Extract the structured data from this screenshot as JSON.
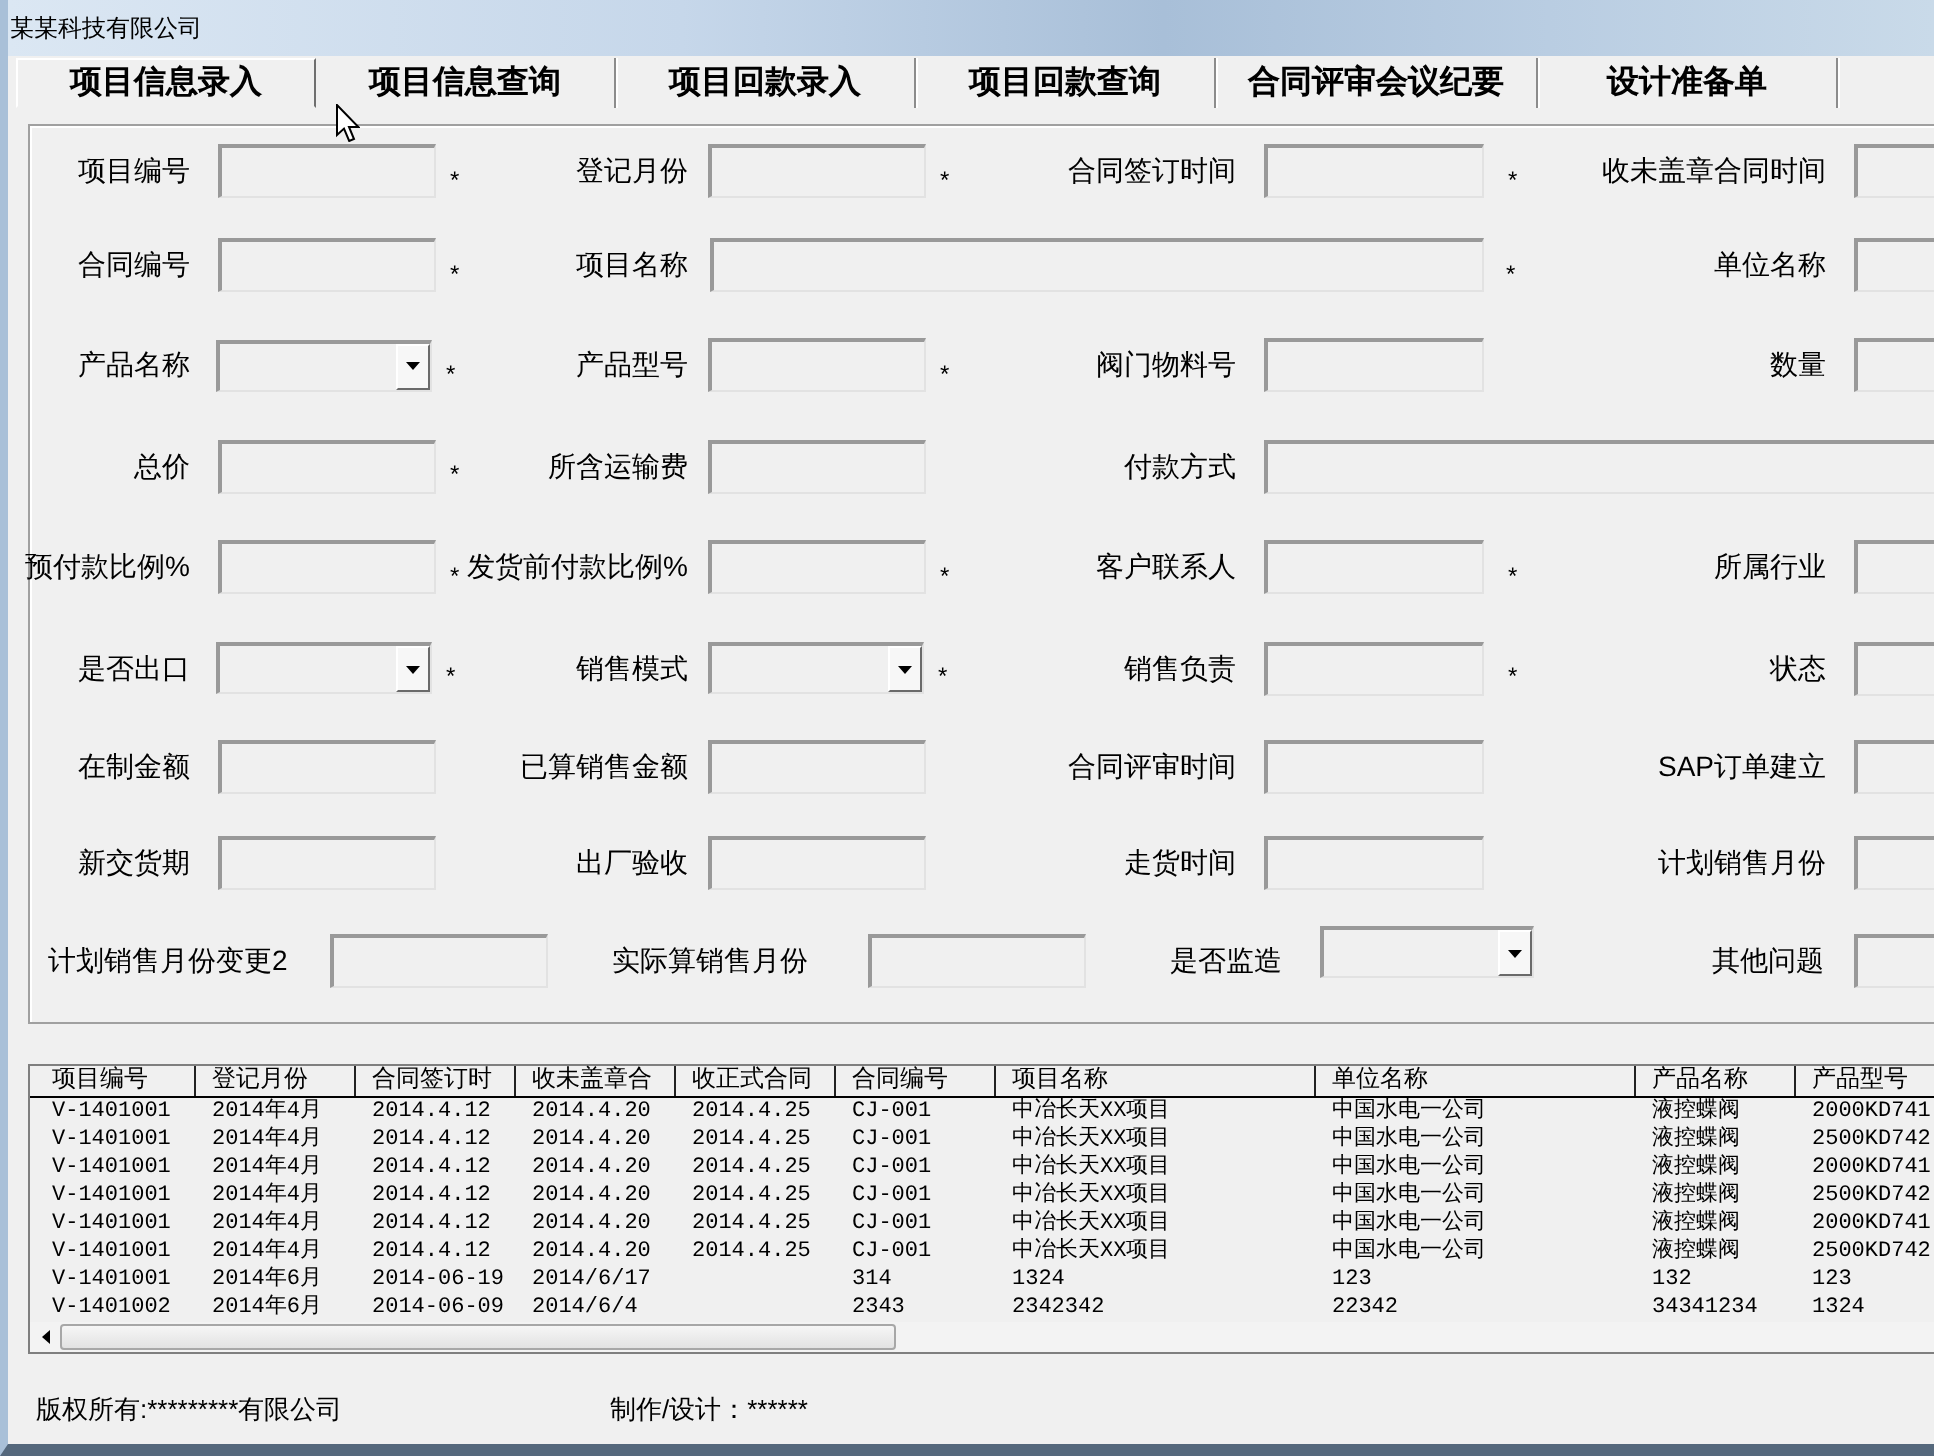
{
  "window": {
    "title": "某某科技有限公司"
  },
  "tabs": [
    {
      "label": "项目信息录入",
      "selected": true
    },
    {
      "label": "项目信息查询",
      "selected": false
    },
    {
      "label": "项目回款录入",
      "selected": false
    },
    {
      "label": "项目回款查询",
      "selected": false
    },
    {
      "label": "合同评审会议纪要",
      "selected": false
    },
    {
      "label": "设计准备单",
      "selected": false
    }
  ],
  "form": {
    "rows": [
      [
        {
          "label": "项目编号",
          "kind": "text",
          "mark": "*"
        },
        {
          "label": "登记月份",
          "kind": "text",
          "mark": "*"
        },
        {
          "label": "合同签订时间",
          "kind": "text",
          "mark": "*"
        },
        {
          "label": "收未盖章合同时间",
          "kind": "text"
        }
      ],
      [
        {
          "label": "合同编号",
          "kind": "text",
          "mark": "*"
        },
        {
          "label": "项目名称",
          "kind": "text",
          "mark": "*"
        },
        null,
        {
          "label": "单位名称",
          "kind": "text"
        }
      ],
      [
        {
          "label": "产品名称",
          "kind": "combo",
          "mark": "*"
        },
        {
          "label": "产品型号",
          "kind": "text",
          "mark": "*"
        },
        {
          "label": "阀门物料号",
          "kind": "text"
        },
        {
          "label": "数量",
          "kind": "text"
        }
      ],
      [
        {
          "label": "总价",
          "kind": "text",
          "mark": "*"
        },
        {
          "label": "所含运输费",
          "kind": "text"
        },
        {
          "label": "付款方式",
          "kind": "text"
        },
        null
      ],
      [
        {
          "label": "预付款比例%",
          "kind": "text",
          "mark": "*"
        },
        {
          "label": "发货前付款比例%",
          "kind": "text",
          "mark": "*"
        },
        {
          "label": "客户联系人",
          "kind": "text",
          "mark": "*"
        },
        {
          "label": "所属行业",
          "kind": "text"
        }
      ],
      [
        {
          "label": "是否出口",
          "kind": "combo",
          "mark": "*"
        },
        {
          "label": "销售模式",
          "kind": "combo",
          "mark": "*"
        },
        {
          "label": "销售负责",
          "kind": "text",
          "mark": "*"
        },
        {
          "label": "状态",
          "kind": "text"
        }
      ],
      [
        {
          "label": "在制金额",
          "kind": "text"
        },
        {
          "label": "已算销售金额",
          "kind": "text"
        },
        {
          "label": "合同评审时间",
          "kind": "text"
        },
        {
          "label": "SAP订单建立",
          "kind": "text"
        }
      ],
      [
        {
          "label": "新交货期",
          "kind": "text"
        },
        {
          "label": "出厂验收",
          "kind": "text"
        },
        {
          "label": "走货时间",
          "kind": "text"
        },
        {
          "label": "计划销售月份",
          "kind": "text"
        }
      ],
      [
        {
          "label": "计划销售月份变更2",
          "kind": "text"
        },
        {
          "label": "实际算销售月份",
          "kind": "text"
        },
        {
          "label": "是否监造",
          "kind": "combo"
        },
        {
          "label": "其他问题",
          "kind": "text"
        }
      ]
    ]
  },
  "table": {
    "columns": [
      "项目编号",
      "登记月份",
      "合同签订时",
      "收未盖章合",
      "收正式合同",
      "合同编号",
      "项目名称",
      "单位名称",
      "产品名称",
      "产品型号"
    ],
    "rows": [
      [
        "V-1401001",
        "2014年4月",
        "2014.4.12",
        "2014.4.20",
        "2014.4.25",
        "CJ-001",
        "中冶长天XX项目",
        "中国水电一公司",
        "液控蝶阀",
        "2000KD741"
      ],
      [
        "V-1401001",
        "2014年4月",
        "2014.4.12",
        "2014.4.20",
        "2014.4.25",
        "CJ-001",
        "中冶长天XX项目",
        "中国水电一公司",
        "液控蝶阀",
        "2500KD742"
      ],
      [
        "V-1401001",
        "2014年4月",
        "2014.4.12",
        "2014.4.20",
        "2014.4.25",
        "CJ-001",
        "中冶长天XX项目",
        "中国水电一公司",
        "液控蝶阀",
        "2000KD741"
      ],
      [
        "V-1401001",
        "2014年4月",
        "2014.4.12",
        "2014.4.20",
        "2014.4.25",
        "CJ-001",
        "中冶长天XX项目",
        "中国水电一公司",
        "液控蝶阀",
        "2500KD742"
      ],
      [
        "V-1401001",
        "2014年4月",
        "2014.4.12",
        "2014.4.20",
        "2014.4.25",
        "CJ-001",
        "中冶长天XX项目",
        "中国水电一公司",
        "液控蝶阀",
        "2000KD741"
      ],
      [
        "V-1401001",
        "2014年4月",
        "2014.4.12",
        "2014.4.20",
        "2014.4.25",
        "CJ-001",
        "中冶长天XX项目",
        "中国水电一公司",
        "液控蝶阀",
        "2500KD742"
      ],
      [
        "V-1401001",
        "2014年6月",
        "2014-06-19",
        "2014/6/17",
        null,
        "314",
        "1324",
        "123",
        "132",
        "123"
      ],
      [
        "V-1401002",
        "2014年6月",
        "2014-06-09",
        "2014/6/4",
        null,
        "2343",
        "2342342",
        "22342",
        "34341234",
        "1324"
      ]
    ]
  },
  "status_bar": {
    "copyright": "版权所有:*********有限公司",
    "credits": "制作/设计：******"
  }
}
